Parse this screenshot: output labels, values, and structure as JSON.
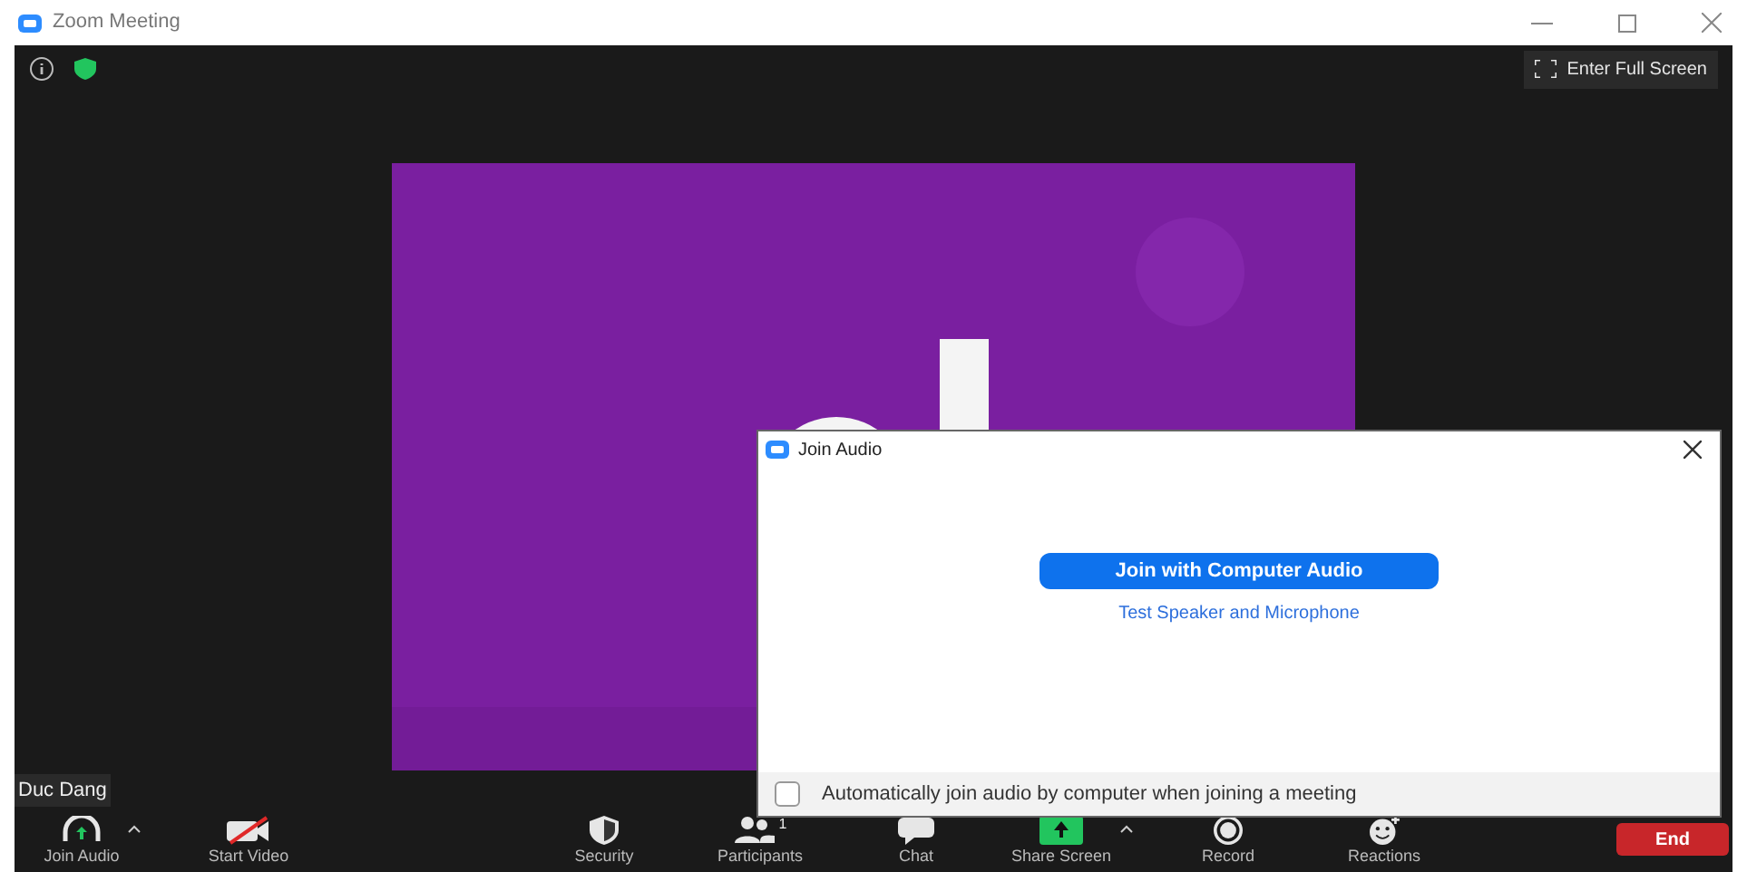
{
  "window": {
    "title": "Zoom Meeting"
  },
  "top_bar": {
    "fullscreen_label": "Enter Full Screen"
  },
  "video": {
    "kind": "picture",
    "participant_name": "Duc Dang"
  },
  "toolbar": [
    {
      "kind": "headphones",
      "label": "Join Audio",
      "caret": true
    },
    {
      "kind": "camera-off",
      "label": "Start Video",
      "caret": false
    },
    {
      "kind": "shield",
      "label": "Security",
      "caret": false
    },
    {
      "kind": "people",
      "label": "Participants",
      "count": "1",
      "caret": false
    },
    {
      "kind": "chat",
      "label": "Chat",
      "caret": false
    },
    {
      "kind": "share",
      "label": "Share Screen",
      "caret": true
    },
    {
      "kind": "record",
      "label": "Record",
      "caret": false
    },
    {
      "kind": "reaction",
      "label": "Reactions",
      "caret": false
    }
  ],
  "end_button": "End",
  "dialog": {
    "title": "Join Audio",
    "primary_button": "Join with Computer Audio",
    "link": "Test Speaker and Microphone",
    "auto_join": {
      "label": "Automatically join audio by computer when joining a meeting",
      "checked": false
    }
  }
}
